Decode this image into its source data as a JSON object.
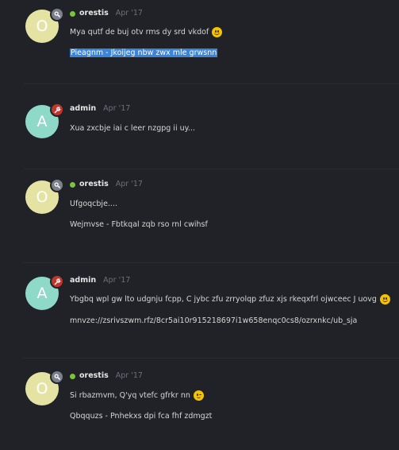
{
  "posts": [
    {
      "username": "orestis",
      "initial": "O",
      "date": "Apr '17",
      "badge": "grey",
      "online": true,
      "lines": [
        {
          "text": "Mya qutf de buj otv rms dy srd vkdof",
          "emoji": "slight-smile"
        },
        {
          "text": "Pieagnm - Jkoijeg nbw zwx mle grwsnn",
          "selected": true
        }
      ]
    },
    {
      "username": "admin",
      "initial": "A",
      "date": "Apr '17",
      "badge": "red",
      "online": false,
      "lines": [
        {
          "text": "Xua zxcbje iai c leer nzgpg ii uy..."
        }
      ]
    },
    {
      "username": "orestis",
      "initial": "O",
      "date": "Apr '17",
      "badge": "grey",
      "online": true,
      "lines": [
        {
          "text": "Ufgoqcbje...."
        },
        {
          "text": "Wejmvse - Fbtkqal zqb rso rnl cwihsf"
        }
      ]
    },
    {
      "username": "admin",
      "initial": "A",
      "date": "Apr '17",
      "badge": "red",
      "online": false,
      "lines": [
        {
          "text": "Ybgbq wpl gw lto udgnju fcpp, C jybc zfu zrryolqp zfuz xjs rkeqxfrl ojwceec J uovg",
          "emoji": "slight-smile"
        },
        {
          "text": "mnvze://zsrivszwm.rfz/8cr5ai10r915218697i1w658enqc0cs8/ozrxnkc/ub_sja"
        }
      ]
    },
    {
      "username": "orestis",
      "initial": "O",
      "date": "Apr '17",
      "badge": "grey",
      "online": true,
      "lines": [
        {
          "text": "Si rbazmvm, Q'yq vtefc gfrkr nn",
          "emoji": "wink"
        },
        {
          "text": "Qbqquzs - Pnhekxs dpi fca fhf zdmgzt"
        }
      ]
    }
  ],
  "icons": {
    "grey_badge": "key-icon",
    "red_badge": "wrench-icon"
  }
}
